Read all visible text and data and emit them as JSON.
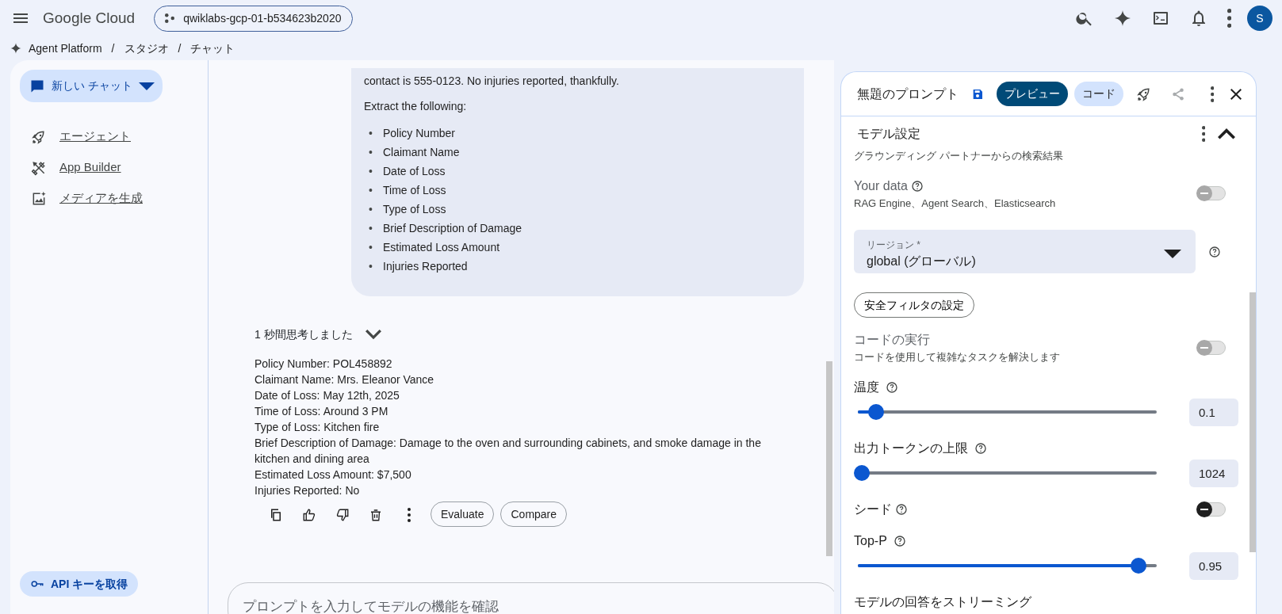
{
  "topbar": {
    "product": "Google Cloud",
    "project": "qwiklabs-gcp-01-b534623b2020",
    "avatar": "S"
  },
  "breadcrumb": {
    "separator": "/",
    "items": [
      "Agent Platform",
      "スタジオ",
      "チャット"
    ]
  },
  "sidebar": {
    "new_chat": "新しい チャット",
    "items": [
      {
        "label": "エージェント"
      },
      {
        "label": "App Builder"
      },
      {
        "label": "メディアを生成"
      }
    ],
    "api_key": "API キーを取得"
  },
  "user_message": {
    "cut_line": "contact is 555-0123. No injuries reported, thankfully.",
    "intro": "Extract the following:",
    "bullet": "•",
    "items": [
      "Policy Number",
      "Claimant Name",
      "Date of Loss",
      "Time of Loss",
      "Type of Loss",
      "Brief Description of Damage",
      "Estimated Loss Amount",
      "Injuries Reported"
    ]
  },
  "response": {
    "thinking": "1 秒間思考しました",
    "expanded": false,
    "lines": [
      "Policy Number: POL458892",
      "Claimant Name: Mrs. Eleanor Vance",
      "Date of Loss: May 12th, 2025",
      "Time of Loss: Around 3 PM",
      "Type of Loss: Kitchen fire",
      "Brief Description of Damage: Damage to the oven and surrounding cabinets, and smoke damage in the kitchen and dining area",
      "Estimated Loss Amount: $7,500",
      "Injuries Reported: No"
    ],
    "actions": [
      "Evaluate",
      "Compare"
    ]
  },
  "prompt_input": {
    "placeholder": "プロンプトを入力してモデルの機能を確認"
  },
  "panel": {
    "title": "無題のプロンプト",
    "tabs": [
      {
        "label": "プレビュー",
        "selected": true
      },
      {
        "label": "コード",
        "selected": false
      }
    ],
    "section": "モデル設定",
    "section_expanded": true,
    "settings": [
      {
        "kind": "note",
        "text": "グラウンディング パートナーからの検索結果"
      },
      {
        "kind": "toggle",
        "label": "Your data",
        "help": true,
        "description": "RAG Engine、Agent Search、Elasticsearch",
        "on": false,
        "disabled": true
      },
      {
        "kind": "select",
        "label": "リージョン *",
        "value": "global (グローバル)"
      },
      {
        "kind": "button",
        "label": "安全フィルタの設定"
      },
      {
        "kind": "toggle",
        "label": "コードの実行",
        "help": false,
        "description": "コードを使用して複雑なタスクを解決します",
        "on": false,
        "disabled": true
      },
      {
        "kind": "slider",
        "label": "温度",
        "level": 0.05,
        "value": "0.1"
      },
      {
        "kind": "slider",
        "label": "出力トークンの上限",
        "level": 0.0,
        "value": "1024"
      },
      {
        "kind": "toggle",
        "label": "シード",
        "help": true,
        "on": false,
        "disabled": false
      },
      {
        "kind": "slider",
        "label": "Top-P",
        "level": 0.95,
        "value": "0.95"
      },
      {
        "kind": "heading",
        "text": "モデルの回答をストリーミング"
      }
    ]
  }
}
